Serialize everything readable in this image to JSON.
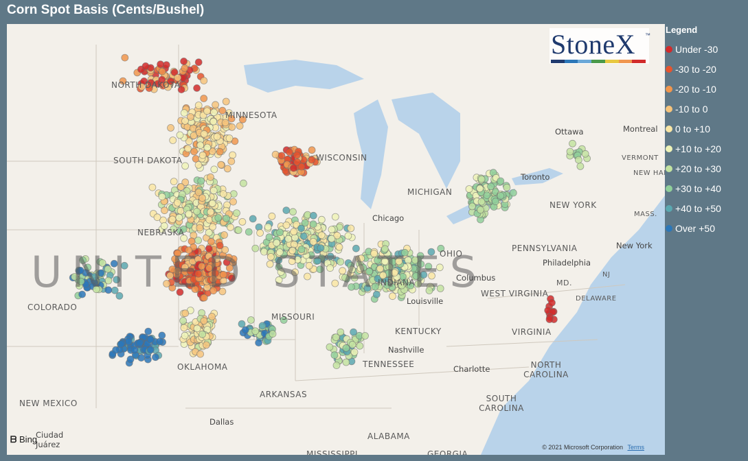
{
  "title": "Corn Spot Basis (Cents/Bushel)",
  "legend": {
    "title": "Legend",
    "items": [
      {
        "label": "Under -30",
        "color": "#d12b2b"
      },
      {
        "label": "-30 to -20",
        "color": "#e4552f"
      },
      {
        "label": "-20 to -10",
        "color": "#f0964e"
      },
      {
        "label": "-10 to 0",
        "color": "#f6c47c"
      },
      {
        "label": "0 to +10",
        "color": "#f9e6a5"
      },
      {
        "label": "+10 to +20",
        "color": "#eef3b8"
      },
      {
        "label": "+20 to +30",
        "color": "#c3e3a1"
      },
      {
        "label": "+30 to +40",
        "color": "#90cf9a"
      },
      {
        "label": "+40 to +50",
        "color": "#5aa8b0"
      },
      {
        "label": "Over +50",
        "color": "#2c77b8"
      }
    ]
  },
  "logo": {
    "text": "StoneX",
    "tm": "™",
    "stripe_colors": [
      "#1f3a6e",
      "#2c77b8",
      "#6aa8d8",
      "#4a9a4a",
      "#e8c840",
      "#f0964e",
      "#d12b2b"
    ]
  },
  "map_labels": {
    "country": "UNITED STATES",
    "states": [
      "NORTH DAKOTA",
      "SOUTH DAKOTA",
      "MINNESOTA",
      "WISCONSIN",
      "MICHIGAN",
      "NEBRASKA",
      "COLORADO",
      "MISSOURI",
      "INDIANA",
      "OHIO",
      "WEST VIRGINIA",
      "VIRGINIA",
      "KENTUCKY",
      "TENNESSEE",
      "NORTH CAROLINA",
      "SOUTH CAROLINA",
      "OKLAHOMA",
      "ARKANSAS",
      "NEW MEXICO",
      "ALABAMA",
      "MISSISSIPPI",
      "GEORGIA",
      "PENNSYLVANIA",
      "NEW YORK",
      "VERMONT",
      "NEW HAMPSHIRE",
      "MASS.",
      "MD.",
      "DELAWARE",
      "NJ"
    ],
    "cities": [
      "Chicago",
      "Toronto",
      "Ottawa",
      "Montreal",
      "New York",
      "Philadelphia",
      "Columbus",
      "Louisville",
      "Nashville",
      "Charlotte",
      "Dallas",
      "Ciudad Juárez"
    ]
  },
  "attribution": {
    "bing": "Bing",
    "copyright": "© 2021 Microsoft Corporation",
    "terms": "Terms"
  }
}
